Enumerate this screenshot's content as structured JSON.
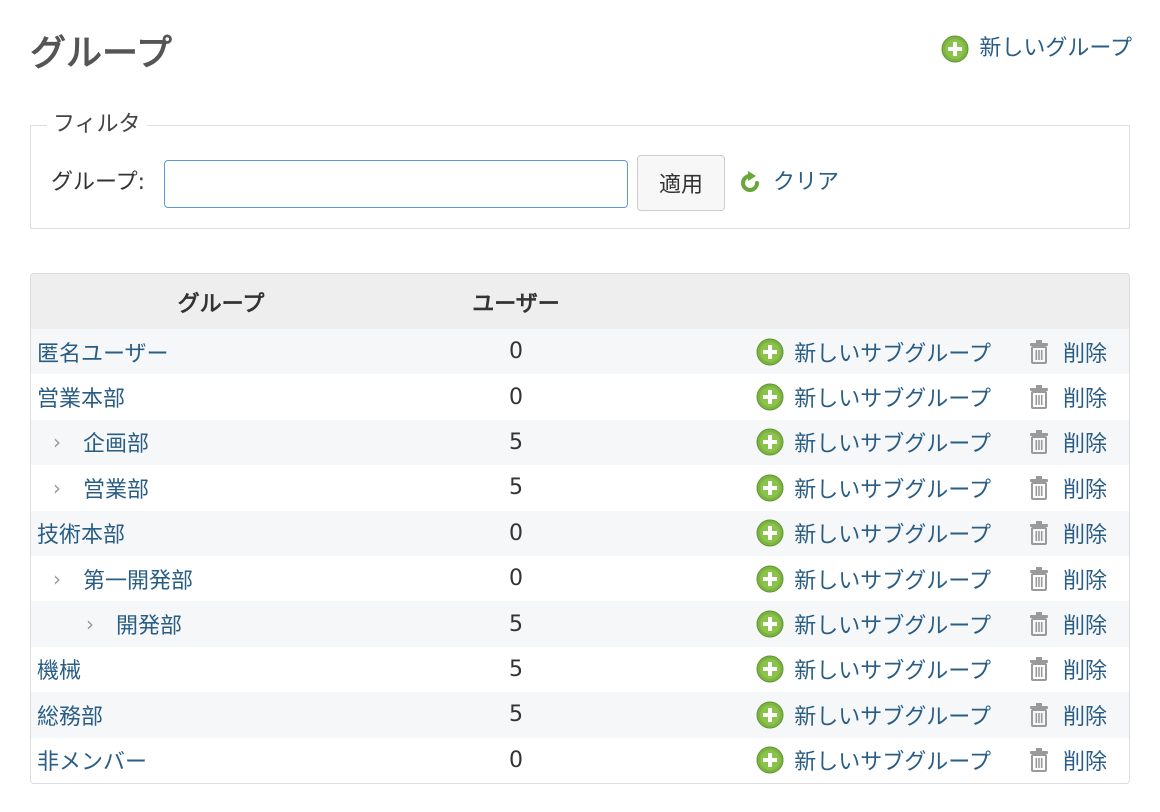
{
  "header": {
    "title": "グループ",
    "new_group_label": "新しいグループ"
  },
  "filter": {
    "legend": "フィルタ",
    "label": "グループ:",
    "input_value": "",
    "apply_label": "適用",
    "clear_label": "クリア"
  },
  "table": {
    "columns": {
      "group": "グループ",
      "users": "ユーザー"
    },
    "action_labels": {
      "new_subgroup": "新しいサブグループ",
      "delete": "削除"
    },
    "rows": [
      {
        "name": "匿名ユーザー",
        "users": "0",
        "level": 0
      },
      {
        "name": "営業本部",
        "users": "0",
        "level": 0
      },
      {
        "name": "企画部",
        "users": "5",
        "level": 1
      },
      {
        "name": "営業部",
        "users": "5",
        "level": 1
      },
      {
        "name": "技術本部",
        "users": "0",
        "level": 0
      },
      {
        "name": "第一開発部",
        "users": "0",
        "level": 1
      },
      {
        "name": "開発部",
        "users": "5",
        "level": 2
      },
      {
        "name": "機械",
        "users": "5",
        "level": 0
      },
      {
        "name": "総務部",
        "users": "5",
        "level": 0
      },
      {
        "name": "非メンバー",
        "users": "0",
        "level": 0
      }
    ]
  },
  "colors": {
    "link": "#2a5d84",
    "plus_icon": "#7cb342",
    "header_bg": "#eeeeee",
    "row_alt_bg": "#f6f7f9"
  },
  "icons": {
    "new": "plus-circle-icon",
    "clear": "reload-icon",
    "delete": "trash-icon",
    "expander": "chevron-right-icon"
  }
}
